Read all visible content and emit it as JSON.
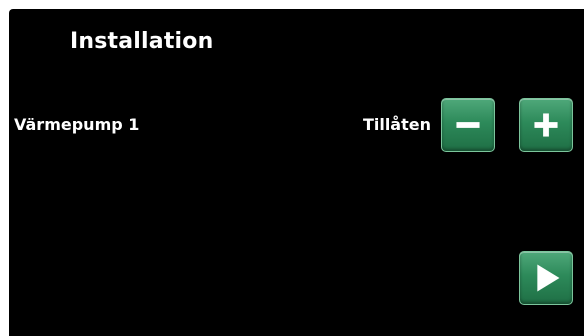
{
  "header": {
    "title": "Installation"
  },
  "settings": {
    "row1": {
      "label": "Värmepump 1",
      "value": "Tillåten"
    }
  },
  "controls": {
    "minus_icon": "minus-icon",
    "plus_icon": "plus-icon",
    "next_icon": "play-arrow-icon"
  },
  "colors": {
    "background": "#000000",
    "text": "#ffffff",
    "button_green": "#2d8a5a"
  }
}
